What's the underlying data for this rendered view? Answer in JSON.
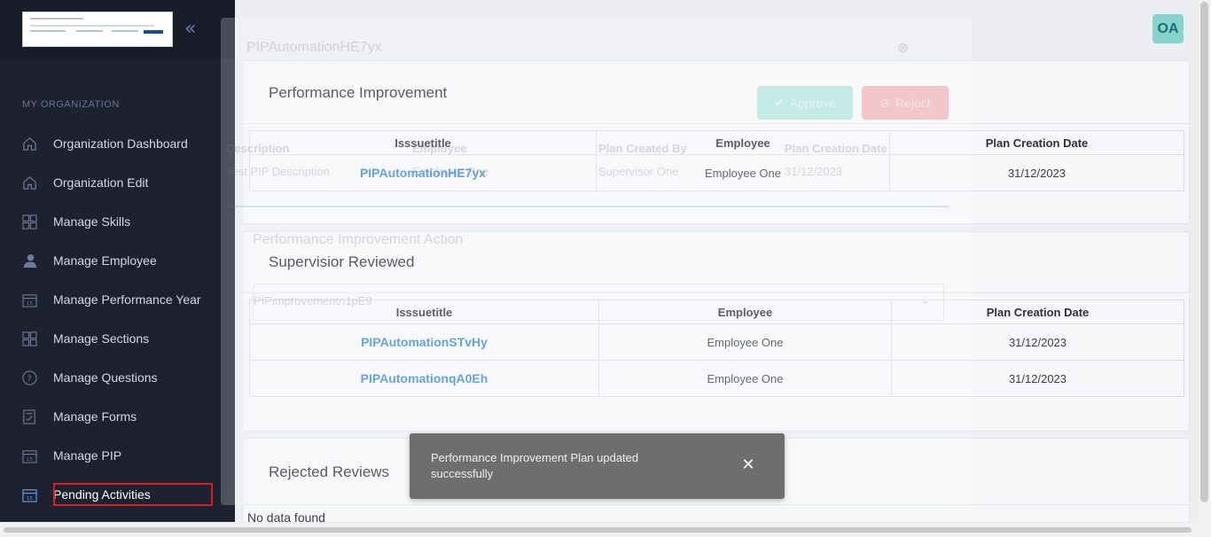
{
  "sidebar": {
    "section_title": "MY ORGANIZATION",
    "collapse_glyph": "«",
    "items": [
      {
        "label": "Organization Dashboard",
        "icon": "home-icon"
      },
      {
        "label": "Organization Edit",
        "icon": "home-icon"
      },
      {
        "label": "Manage Skills",
        "icon": "grid-icon"
      },
      {
        "label": "Manage Employee",
        "icon": "user-icon"
      },
      {
        "label": "Manage Performance Year",
        "icon": "calendar-icon"
      },
      {
        "label": "Manage Sections",
        "icon": "grid-icon"
      },
      {
        "label": "Manage Questions",
        "icon": "question-icon"
      },
      {
        "label": "Manage Forms",
        "icon": "form-icon"
      },
      {
        "label": "Manage PIP",
        "icon": "calendar-icon"
      },
      {
        "label": "Pending Activities",
        "icon": "calendar-icon",
        "active": true
      }
    ]
  },
  "header": {
    "avatar_initials": "OA"
  },
  "background_modal": {
    "title": "PIPAutomationHE7yx",
    "approve_label": "Approve",
    "reject_label": "Reject",
    "columns": [
      "Description",
      "Employee",
      "Plan Created By",
      "Plan Creation Date"
    ],
    "row": [
      "Test PIP Description",
      "Employee One",
      "Supervisor One",
      "31/12/2023"
    ],
    "action_title": "Performance Improvement Action",
    "action_select": "PIPimprovementn1pE9"
  },
  "performance_improvement": {
    "title": "Performance Improvement",
    "columns": [
      "Isssuetitle",
      "Employee",
      "Plan Creation Date"
    ],
    "rows": [
      {
        "title": "PIPAutomationHE7yx",
        "employee": "Employee One",
        "date": "31/12/2023"
      }
    ]
  },
  "supervisor_reviewed": {
    "title": "Supervisior Reviewed",
    "columns": [
      "Isssuetitle",
      "Employee",
      "Plan Creation Date"
    ],
    "rows": [
      {
        "title": "PIPAutomationSTvHy",
        "employee": "Employee One",
        "date": "31/12/2023"
      },
      {
        "title": "PIPAutomationqA0Eh",
        "employee": "Employee One",
        "date": "31/12/2023"
      }
    ]
  },
  "rejected_reviews": {
    "title": "Rejected Reviews",
    "empty_text": "No data found"
  },
  "toast": {
    "message": "Performance Improvement Plan updated successfully",
    "close_glyph": "✕"
  },
  "colors": {
    "sidebar_bg": "#1e2130",
    "link": "#3c8ad6",
    "avatar_bg": "#87d3cd",
    "highlight": "#d61f1f",
    "toast_bg": "#6e6e6e"
  }
}
